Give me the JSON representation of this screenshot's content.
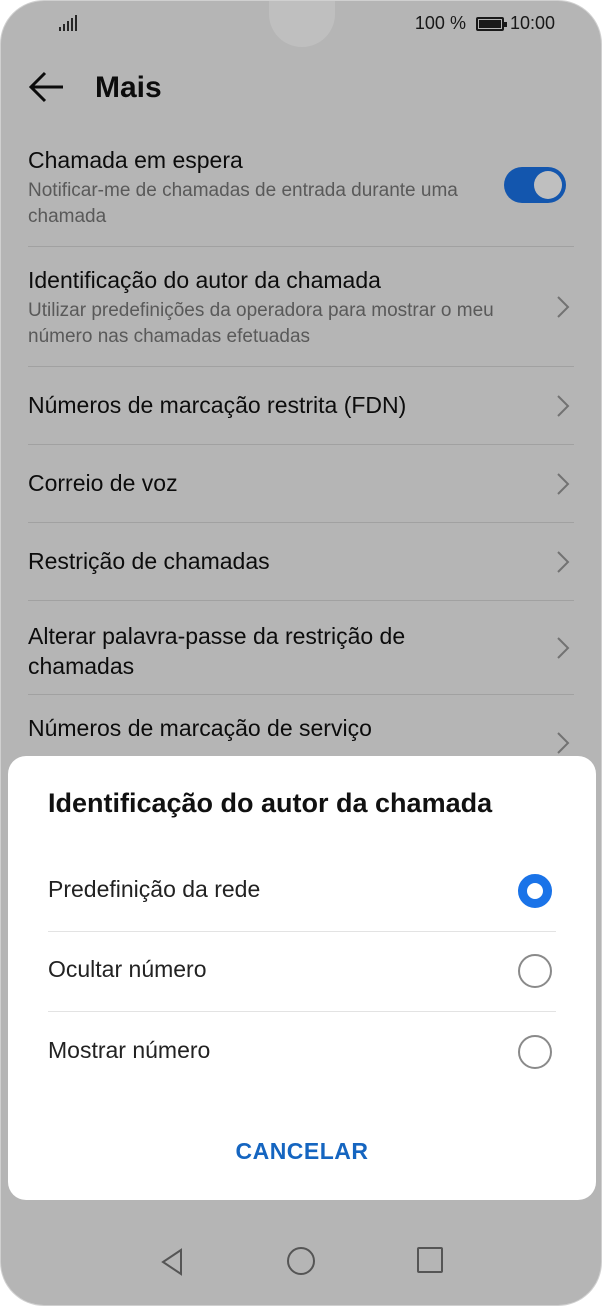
{
  "status_bar": {
    "battery_percent": "100 %",
    "time": "10:00"
  },
  "app_bar": {
    "title": "Mais",
    "back_icon": "arrow-left-icon"
  },
  "settings": {
    "items": [
      {
        "title": "Chamada em espera",
        "subtitle": "Notificar-me de chamadas de entrada durante uma chamada",
        "control": "toggle-on"
      },
      {
        "title": "Identificação do autor da chamada",
        "subtitle": "Utilizar predefinições da operadora para mostrar o meu número nas chamadas efetuadas",
        "control": "chevron"
      },
      {
        "title": "Números de marcação restrita (FDN)",
        "control": "chevron"
      },
      {
        "title": "Correio de voz",
        "control": "chevron"
      },
      {
        "title": "Restrição de chamadas",
        "control": "chevron"
      },
      {
        "title": "Alterar palavra-passe da restrição de chamadas",
        "control": "chevron"
      },
      {
        "title": "Números de marcação de serviço",
        "control": "chevron"
      }
    ]
  },
  "dialog": {
    "title": "Identificação do autor da chamada",
    "options": [
      {
        "label": "Predefinição da rede",
        "selected": true
      },
      {
        "label": "Ocultar número",
        "selected": false
      },
      {
        "label": "Mostrar número",
        "selected": false
      }
    ],
    "cancel_label": "CANCELAR"
  },
  "colors": {
    "accent": "#1a73e8",
    "cancel_text": "#1565c0"
  }
}
